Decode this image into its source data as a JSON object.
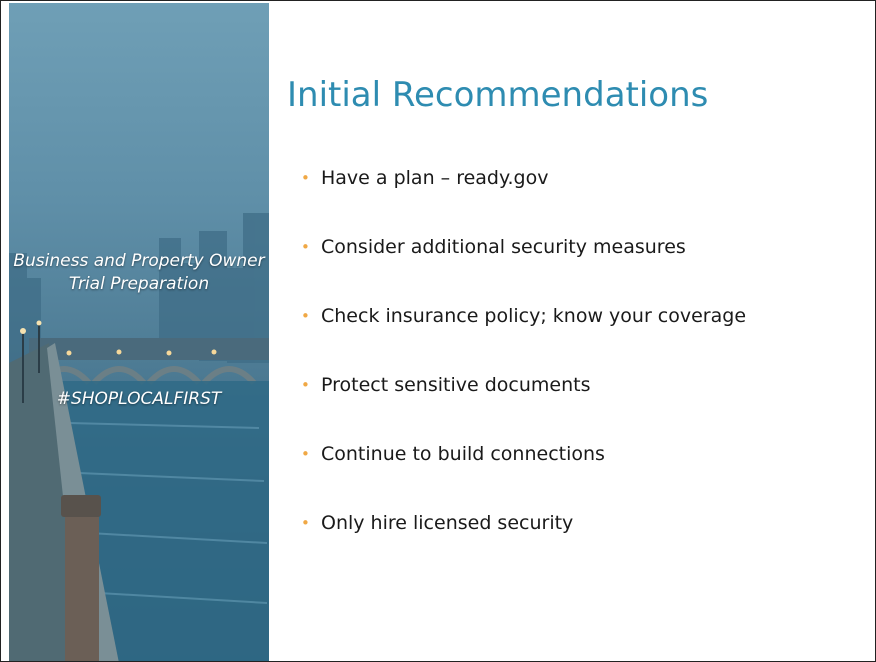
{
  "side_panel": {
    "title": "Business and Property Owner Trial Preparation",
    "hashtag": "#SHOPLOCALFIRST"
  },
  "main": {
    "title": "Initial Recommendations",
    "bullet_glyph": "•",
    "bullets": [
      "Have a plan – ready.gov",
      "Consider additional security measures",
      "Check insurance policy; know your coverage",
      "Protect sensitive documents",
      "Continue to build connections",
      "Only hire licensed security"
    ]
  },
  "colors": {
    "title": "#2e8cb1",
    "bullet": "#f0a845",
    "panel_overlay": "#4d7b94"
  }
}
